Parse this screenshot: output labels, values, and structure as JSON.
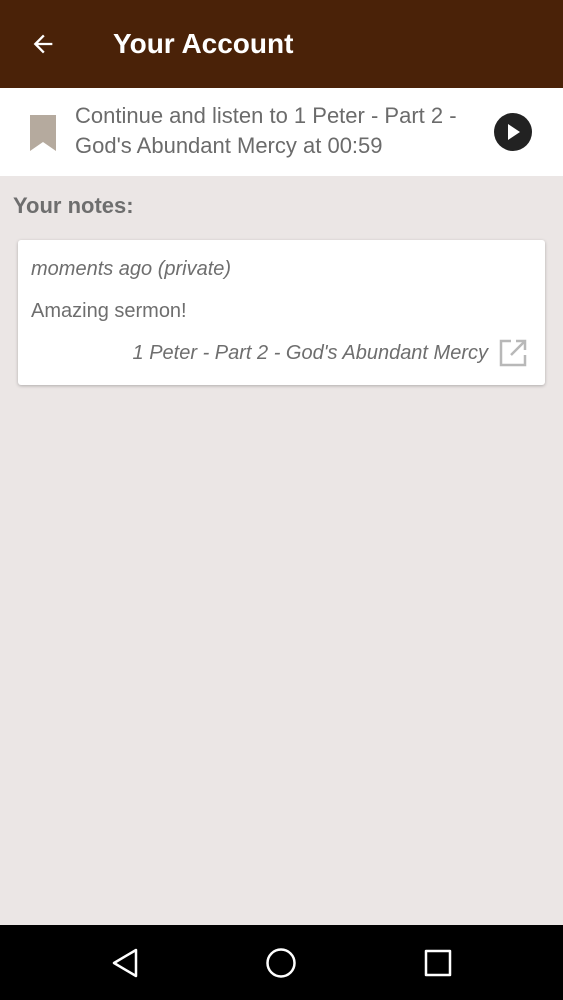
{
  "appbar": {
    "title": "Your Account",
    "back_icon": "arrow-left-icon"
  },
  "resume": {
    "text": "Continue and listen to 1 Peter - Part 2 - God's Abundant Mercy at 00:59",
    "bookmark_icon": "bookmark-icon",
    "play_icon": "play-icon"
  },
  "notes": {
    "heading": "Your notes:",
    "items": [
      {
        "meta": "moments ago (private)",
        "body": "Amazing sermon!",
        "sermon": "1 Peter - Part 2 - God's Abundant Mercy",
        "open_icon": "open-in-new-icon"
      }
    ]
  },
  "navbar": {
    "back_icon": "nav-back-icon",
    "home_icon": "nav-home-icon",
    "recents_icon": "nav-recents-icon"
  },
  "colors": {
    "appbar": "#4a2208",
    "background": "#ebe6e5",
    "text": "#6e6e6e",
    "bookmark": "#b5aa9e"
  }
}
